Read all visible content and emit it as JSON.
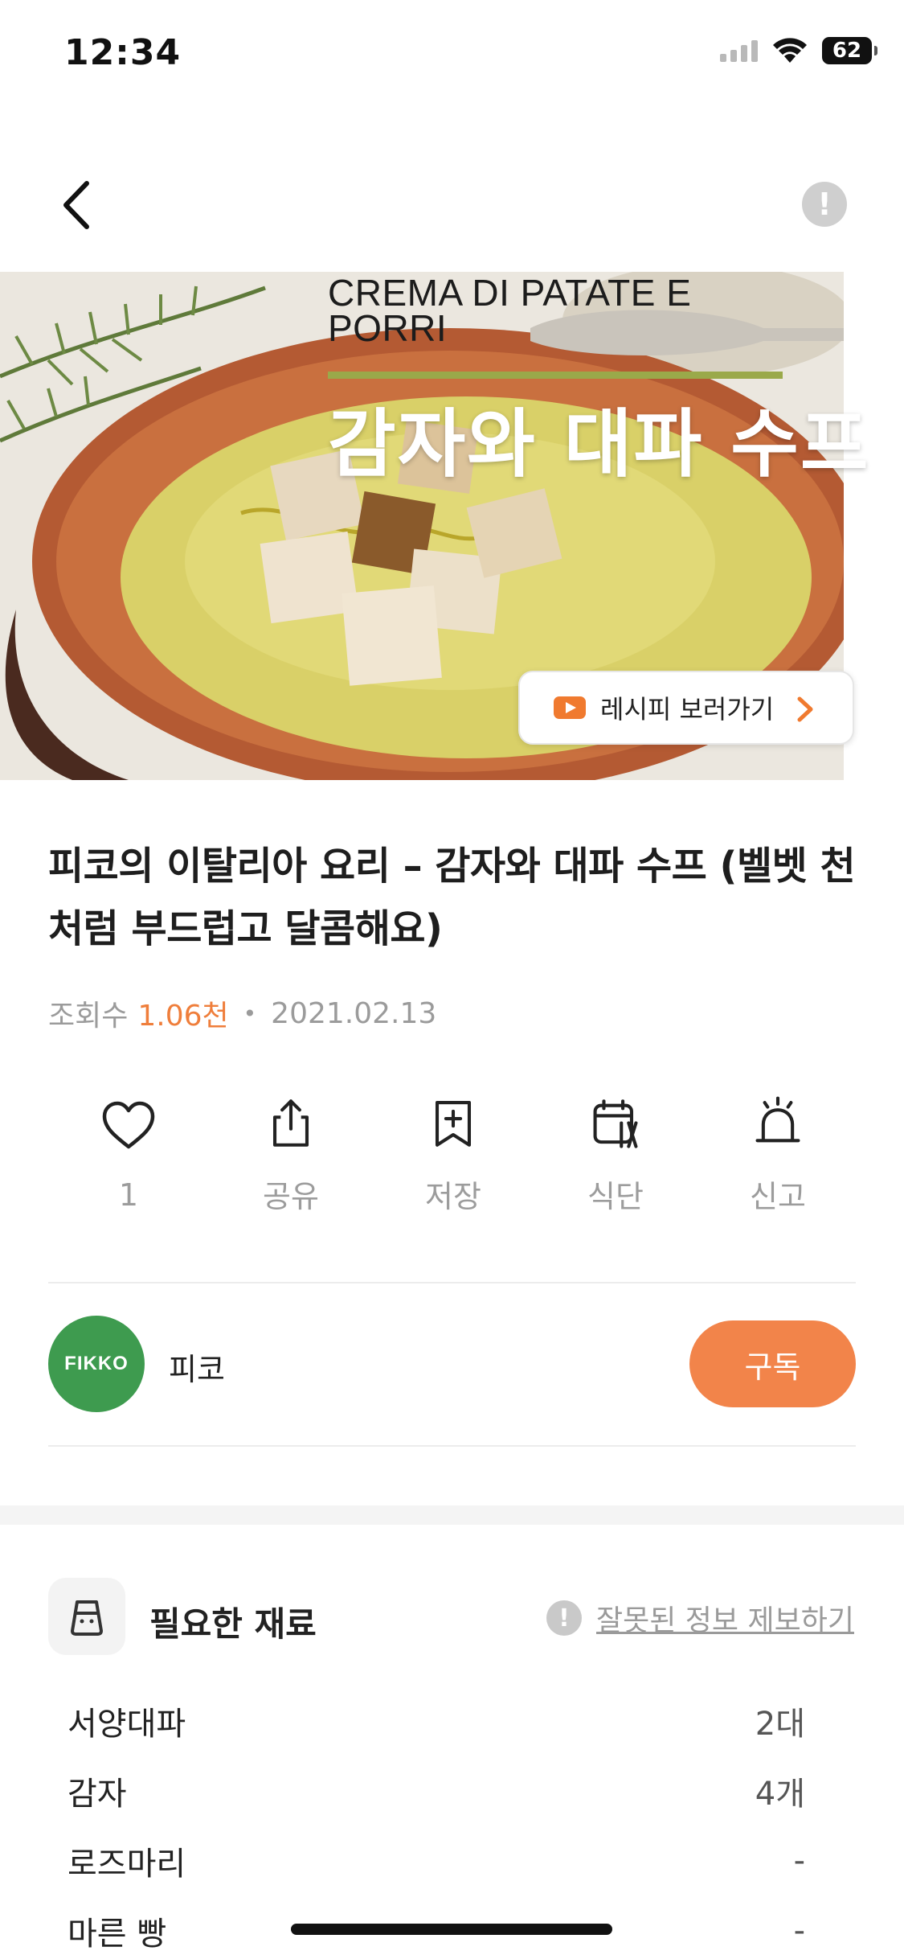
{
  "status_bar": {
    "time": "12:34",
    "battery": "62"
  },
  "hero": {
    "title_italian": "CREMA DI PATATE E PORRI",
    "title_korean": "감자와 대파 수프",
    "recipe_link_label": "레시피 보러가기"
  },
  "post": {
    "title": "피코의 이탈리아 요리 – 감자와 대파 수프 (벨벳 천처럼 부드럽고 달콤해요)",
    "views_label": "조회수",
    "views_value": "1.06천",
    "date": "2021.02.13"
  },
  "actions": [
    {
      "label": "1",
      "icon": "heart-icon"
    },
    {
      "label": "공유",
      "icon": "share-icon"
    },
    {
      "label": "저장",
      "icon": "bookmark-add-icon"
    },
    {
      "label": "식단",
      "icon": "meal-calendar-icon"
    },
    {
      "label": "신고",
      "icon": "alarm-bell-icon"
    }
  ],
  "author": {
    "avatar_text": "FIKKO",
    "name": "피코",
    "subscribe_label": "구독"
  },
  "ingredients": {
    "title": "필요한 재료",
    "report_label": "잘못된 정보 제보하기",
    "items": [
      {
        "name": "서양대파",
        "amount": "2대"
      },
      {
        "name": "감자",
        "amount": "4개"
      },
      {
        "name": "로즈마리",
        "amount": "-"
      },
      {
        "name": "마른 빵",
        "amount": "-"
      }
    ]
  },
  "colors": {
    "accent": "#f2844a",
    "avatar": "#3e9b4f",
    "rule": "#9aa94a"
  }
}
